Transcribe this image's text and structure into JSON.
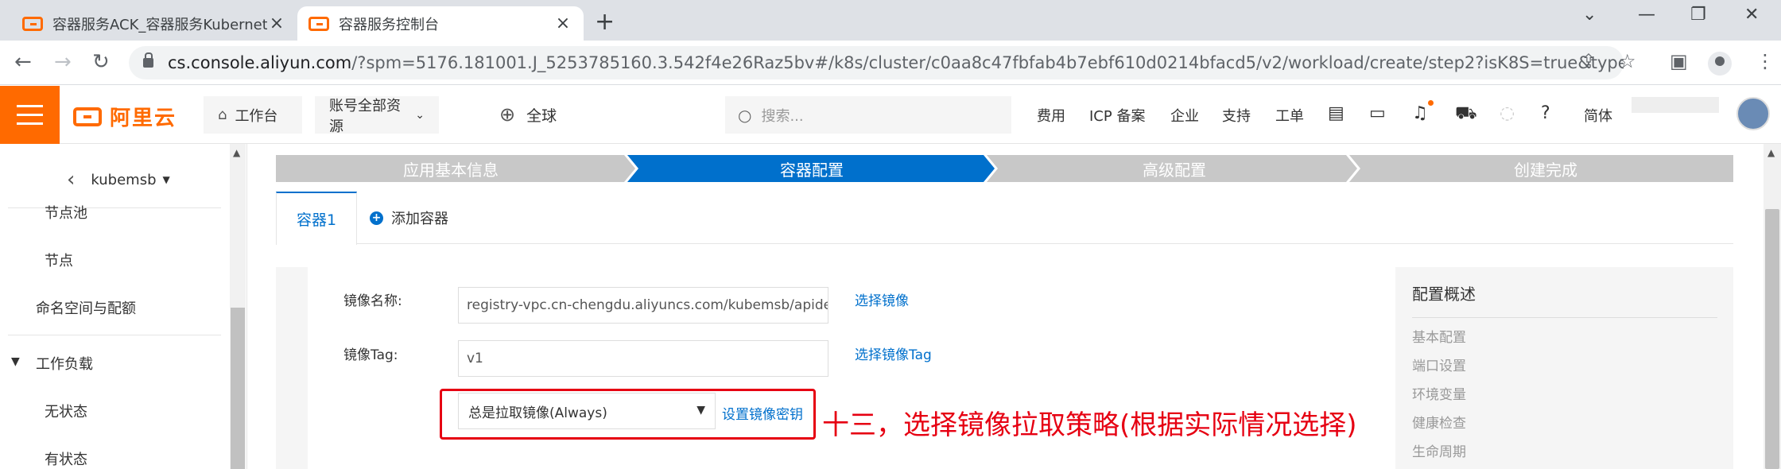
{
  "browser": {
    "tabs": [
      {
        "title": "容器服务ACK_容器服务Kubernetes",
        "close": "×"
      },
      {
        "title": "容器服务控制台",
        "close": "×"
      }
    ],
    "new_tab": "+",
    "window_controls": {
      "minimize": "—",
      "restore": "❐",
      "close": "✕",
      "dropdown": "⌄"
    },
    "nav": {
      "back": "←",
      "forward": "→",
      "reload": "↻"
    },
    "url_host": "cs.console.aliyun.com",
    "url_path": "/?spm=5176.181001.J_5253785160.3.542f4e26Raz5bv#/k8s/cluster/c0aa8c47fbfab4b7ebf610d0214bfacd5/v2/workload/create/step2?isK8S=true&type..."
  },
  "header": {
    "logo_text": "阿里云",
    "workbench": "工作台",
    "resources": "账号全部资源",
    "region": "全球",
    "search_placeholder": "搜索...",
    "links": [
      "费用",
      "ICP 备案",
      "企业",
      "支持",
      "工单"
    ],
    "lang": "简体"
  },
  "sidebar": {
    "cluster_name": "kubemsb",
    "items": [
      "节点池",
      "节点",
      "命名空间与配额",
      "工作负载",
      "无状态",
      "有状态"
    ]
  },
  "steps": [
    "应用基本信息",
    "容器配置",
    "高级配置",
    "创建完成"
  ],
  "active_step": 1,
  "container_tabs": {
    "active": "容器1",
    "add": "添加容器"
  },
  "form": {
    "image_name_label": "镜像名称:",
    "image_name_value": "registry-vpc.cn-chengdu.aliyuncs.com/kubemsb/apidemo",
    "select_image": "选择镜像",
    "image_tag_label": "镜像Tag:",
    "image_tag_value": "v1",
    "select_image_tag": "选择镜像Tag",
    "pull_policy": "总是拉取镜像(Always)",
    "set_secret": "设置镜像密钥"
  },
  "annotation": "十三，选择镜像拉取策略(根据实际情况选择)",
  "summary": {
    "title": "配置概述",
    "items": [
      "基本配置",
      "端口设置",
      "环境变量",
      "健康检查",
      "生命周期"
    ]
  },
  "colors": {
    "accent": "#0070cc",
    "brand": "#ff6a00",
    "annotation": "#e60012",
    "step_inactive": "#c8c8c8"
  }
}
